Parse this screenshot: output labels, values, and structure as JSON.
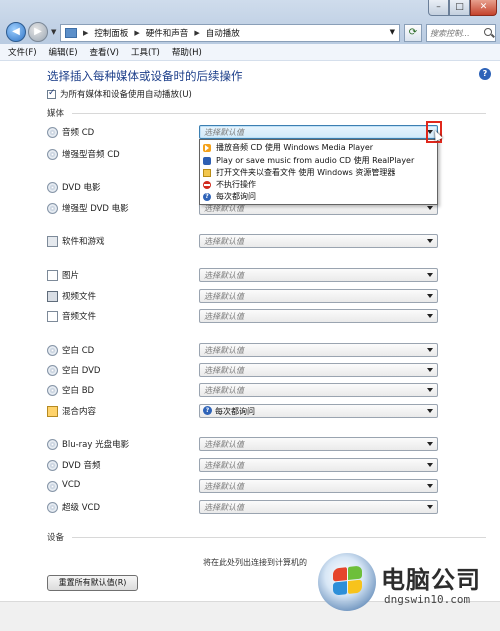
{
  "window": {
    "minimize": "–",
    "maximize": "□",
    "close": "✕"
  },
  "address_bar": {
    "breadcrumbs": [
      "控制面板",
      "硬件和声音",
      "自动播放"
    ],
    "search_placeholder": "搜索控制..."
  },
  "menu": [
    "文件(F)",
    "编辑(E)",
    "查看(V)",
    "工具(T)",
    "帮助(H)"
  ],
  "page": {
    "title": "选择插入每种媒体或设备时的后续操作",
    "autoplay_checkbox_label": "为所有媒体和设备使用自动播放(U)",
    "autoplay_checked": true,
    "media_section": "媒体",
    "devices_section": "设备",
    "device_hint": "将在此处列出连接到计算机的",
    "reset_button": "重置所有默认值(R)"
  },
  "media_rows": [
    {
      "label": "音频 CD",
      "value": "选择默认值",
      "icon": "cd-icon"
    },
    {
      "label": "增强型音频 CD",
      "value": "选择默认值",
      "icon": "cd-icon"
    },
    {
      "label": "DVD 电影",
      "value": "选择默认值",
      "icon": "dvd-icon"
    },
    {
      "label": "增强型 DVD 电影",
      "value": "选择默认值",
      "icon": "dvd-icon"
    },
    {
      "label": "软件和游戏",
      "value": "选择默认值",
      "icon": "software-icon"
    },
    {
      "label": "图片",
      "value": "选择默认值",
      "icon": "picture-icon"
    },
    {
      "label": "视频文件",
      "value": "选择默认值",
      "icon": "video-icon"
    },
    {
      "label": "音频文件",
      "value": "选择默认值",
      "icon": "music-icon"
    },
    {
      "label": "空白 CD",
      "value": "选择默认值",
      "icon": "cd-icon"
    },
    {
      "label": "空白 DVD",
      "value": "选择默认值",
      "icon": "cd-icon"
    },
    {
      "label": "空白 BD",
      "value": "选择默认值",
      "icon": "cd-icon"
    },
    {
      "label": "混合内容",
      "value": "每次都询问",
      "icon": "mixed-icon"
    },
    {
      "label": "Blu-ray 光盘电影",
      "value": "选择默认值",
      "icon": "bluray-icon"
    },
    {
      "label": "DVD 音频",
      "value": "选择默认值",
      "icon": "cd-icon"
    },
    {
      "label": "VCD",
      "value": "选择默认值",
      "icon": "cd-icon"
    },
    {
      "label": "超级 VCD",
      "value": "选择默认值",
      "icon": "cd-icon"
    }
  ],
  "dropdown_options": [
    {
      "label": "播放音频 CD 使用 Windows Media Player",
      "icon": "media-player-icon"
    },
    {
      "label": "Play or save music from audio CD 使用 RealPlayer",
      "icon": "realplayer-icon"
    },
    {
      "label": "打开文件夹以查看文件 使用 Windows 资源管理器",
      "icon": "folder-icon"
    },
    {
      "label": "不执行操作",
      "icon": "stop-icon"
    },
    {
      "label": "每次都询问",
      "icon": "question-icon"
    }
  ],
  "watermark": {
    "brand": "电脑公司",
    "url": "dngswin10.com"
  }
}
